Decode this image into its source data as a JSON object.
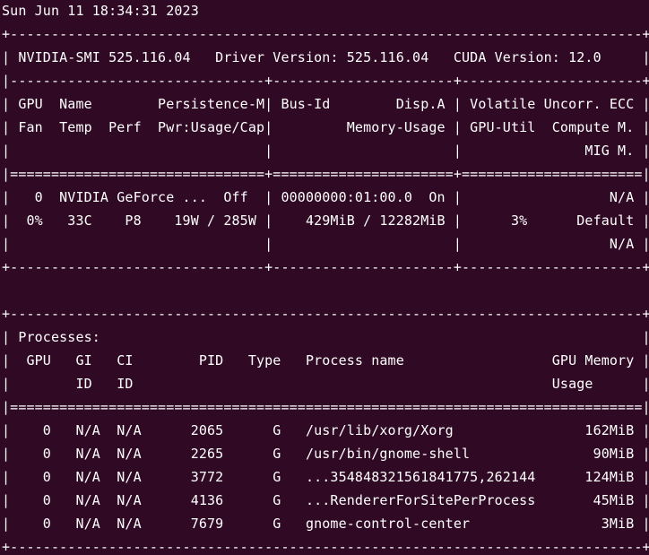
{
  "terminal": {
    "background": "#300a24",
    "foreground": "#ffffff",
    "lines": [
      "Sun Jun 11 18:34:31 2023",
      "+-----------------------------------------------------------------------------+",
      "| NVIDIA-SMI 525.116.04   Driver Version: 525.116.04   CUDA Version: 12.0     |",
      "|-------------------------------+----------------------+----------------------+",
      "| GPU  Name        Persistence-M| Bus-Id        Disp.A | Volatile Uncorr. ECC |",
      "| Fan  Temp  Perf  Pwr:Usage/Cap|         Memory-Usage | GPU-Util  Compute M. |",
      "|                               |                      |               MIG M. |",
      "|===============================+======================+======================|",
      "|   0  NVIDIA GeForce ...  Off  | 00000000:01:00.0  On |                  N/A |",
      "|  0%   33C    P8    19W / 285W |    429MiB / 12282MiB |      3%      Default |",
      "|                               |                      |                  N/A |",
      "+-------------------------------+----------------------+----------------------+",
      "",
      "+-----------------------------------------------------------------------------+",
      "| Processes:                                                                  |",
      "|  GPU   GI   CI        PID   Type   Process name                  GPU Memory |",
      "|        ID   ID                                                   Usage      |",
      "|=============================================================================|",
      "|    0   N/A  N/A      2065      G   /usr/lib/xorg/Xorg                162MiB |",
      "|    0   N/A  N/A      2265      G   /usr/bin/gnome-shell               90MiB |",
      "|    0   N/A  N/A      3772      G   ...354848321561841775,262144      124MiB |",
      "|    0   N/A  N/A      4136      G   ...RendererForSitePerProcess       45MiB |",
      "|    0   N/A  N/A      7679      G   gnome-control-center                3MiB |",
      "+-----------------------------------------------------------------------------+"
    ]
  }
}
